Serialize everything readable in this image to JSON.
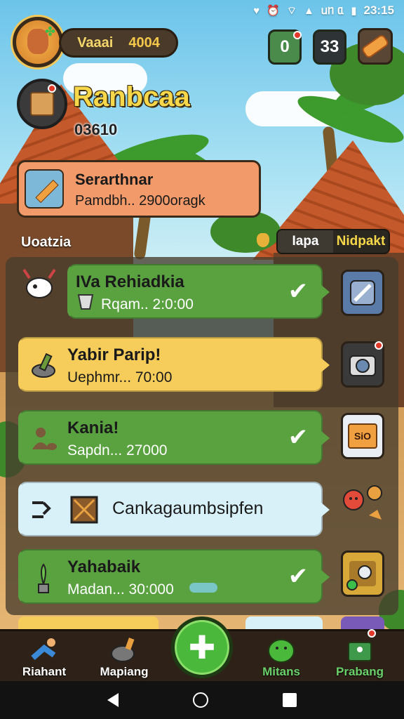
{
  "status_bar": {
    "carrier_text": "ᥙᥒ ᥲ",
    "time": "23:15"
  },
  "hud": {
    "player_name": "Vaaai",
    "player_score": "4004",
    "counter_a": "0",
    "counter_b": "33"
  },
  "quest_header": {
    "title": "Ranbcaa",
    "subtitle": "03610"
  },
  "banner": {
    "title": "Serarthnar",
    "subtitle": "Pamdbh.. 2900oragk"
  },
  "section": {
    "left_label": "Uoatzia",
    "tabs": [
      {
        "label": "Iapa"
      },
      {
        "label": "Nidpakt"
      }
    ]
  },
  "quests": [
    {
      "title": "IVa Rehiadkia",
      "detail": "Rqam.. 2:0:00",
      "style": "green",
      "done": true
    },
    {
      "title": "Yabir Parip!",
      "detail": "Uephmr... 70:00",
      "style": "yellow",
      "done": false
    },
    {
      "title": "Kania!",
      "detail": "Sapdn... 27000",
      "style": "green",
      "done": true
    },
    {
      "title": "Cankagaumbsipfen",
      "detail": "",
      "style": "blue",
      "done": false
    },
    {
      "title": "Yahabaik",
      "detail": "Madan... 30:000",
      "style": "green",
      "done": true
    }
  ],
  "side_badge_text": "SiO",
  "bottom_nav": [
    {
      "label": "Riahant",
      "icon": "runner-icon"
    },
    {
      "label": "Mapiang",
      "icon": "pot-icon"
    },
    {
      "label": "Mitans",
      "icon": "slime-icon"
    },
    {
      "label": "Prabang",
      "icon": "map-icon"
    }
  ],
  "colors": {
    "accent_green": "#5aa240",
    "accent_yellow": "#f6cd5a",
    "banner_orange": "#f29a6a",
    "title_yellow": "#f6d84a",
    "nav_bg": "#2e2218"
  }
}
